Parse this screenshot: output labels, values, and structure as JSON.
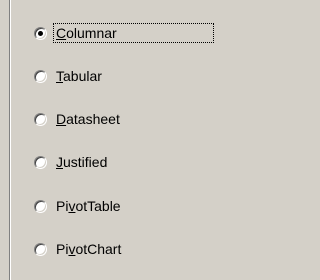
{
  "options": [
    {
      "pre": "",
      "ul": "C",
      "post": "olumnar",
      "checked": true
    },
    {
      "pre": "",
      "ul": "T",
      "post": "abular",
      "checked": false
    },
    {
      "pre": "",
      "ul": "D",
      "post": "atasheet",
      "checked": false
    },
    {
      "pre": "",
      "ul": "J",
      "post": "ustified",
      "checked": false
    },
    {
      "pre": "Pi",
      "ul": "v",
      "post": "otTable",
      "checked": false
    },
    {
      "pre": "Pi",
      "ul": "v",
      "post": "otChart",
      "checked": false
    }
  ]
}
